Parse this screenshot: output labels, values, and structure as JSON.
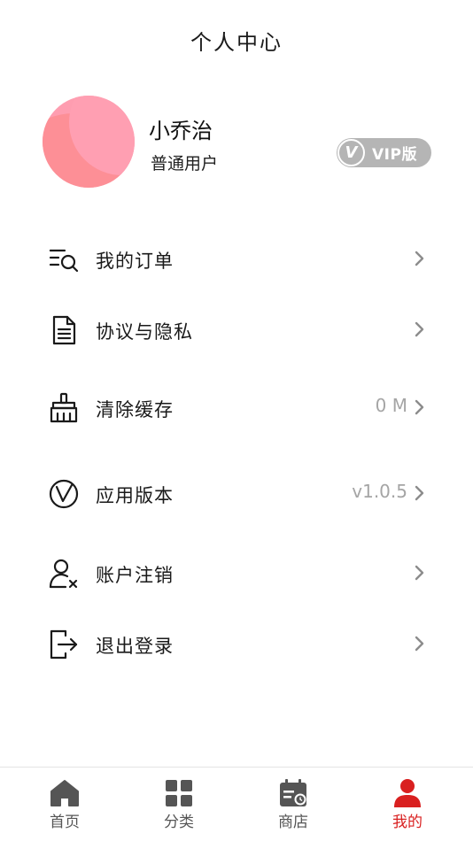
{
  "header": {
    "title": "个人中心"
  },
  "profile": {
    "name": "小乔治",
    "user_type": "普通用户",
    "vip_label": "VIP版",
    "vip_icon_letter": "V"
  },
  "menu": {
    "orders": {
      "label": "我的订单",
      "icon": "order-search-icon"
    },
    "privacy": {
      "label": "协议与隐私",
      "icon": "document-icon"
    },
    "cache": {
      "label": "清除缓存",
      "value": "0 M",
      "icon": "broom-icon"
    },
    "version": {
      "label": "应用版本",
      "value": "v1.0.5",
      "icon": "version-v-icon"
    },
    "cancel_account": {
      "label": "账户注销",
      "icon": "user-remove-icon"
    },
    "logout": {
      "label": "退出登录",
      "icon": "logout-icon"
    }
  },
  "tabs": [
    {
      "label": "首页",
      "icon": "home-icon",
      "active": false
    },
    {
      "label": "分类",
      "icon": "grid-icon",
      "active": false
    },
    {
      "label": "商店",
      "icon": "calendar-store-icon",
      "active": false
    },
    {
      "label": "我的",
      "icon": "user-icon",
      "active": true
    }
  ],
  "colors": {
    "accent": "#d92020",
    "avatar": "#fe9db0",
    "vip_badge": "#b5b5b5",
    "muted_text": "#a5a5a5"
  }
}
